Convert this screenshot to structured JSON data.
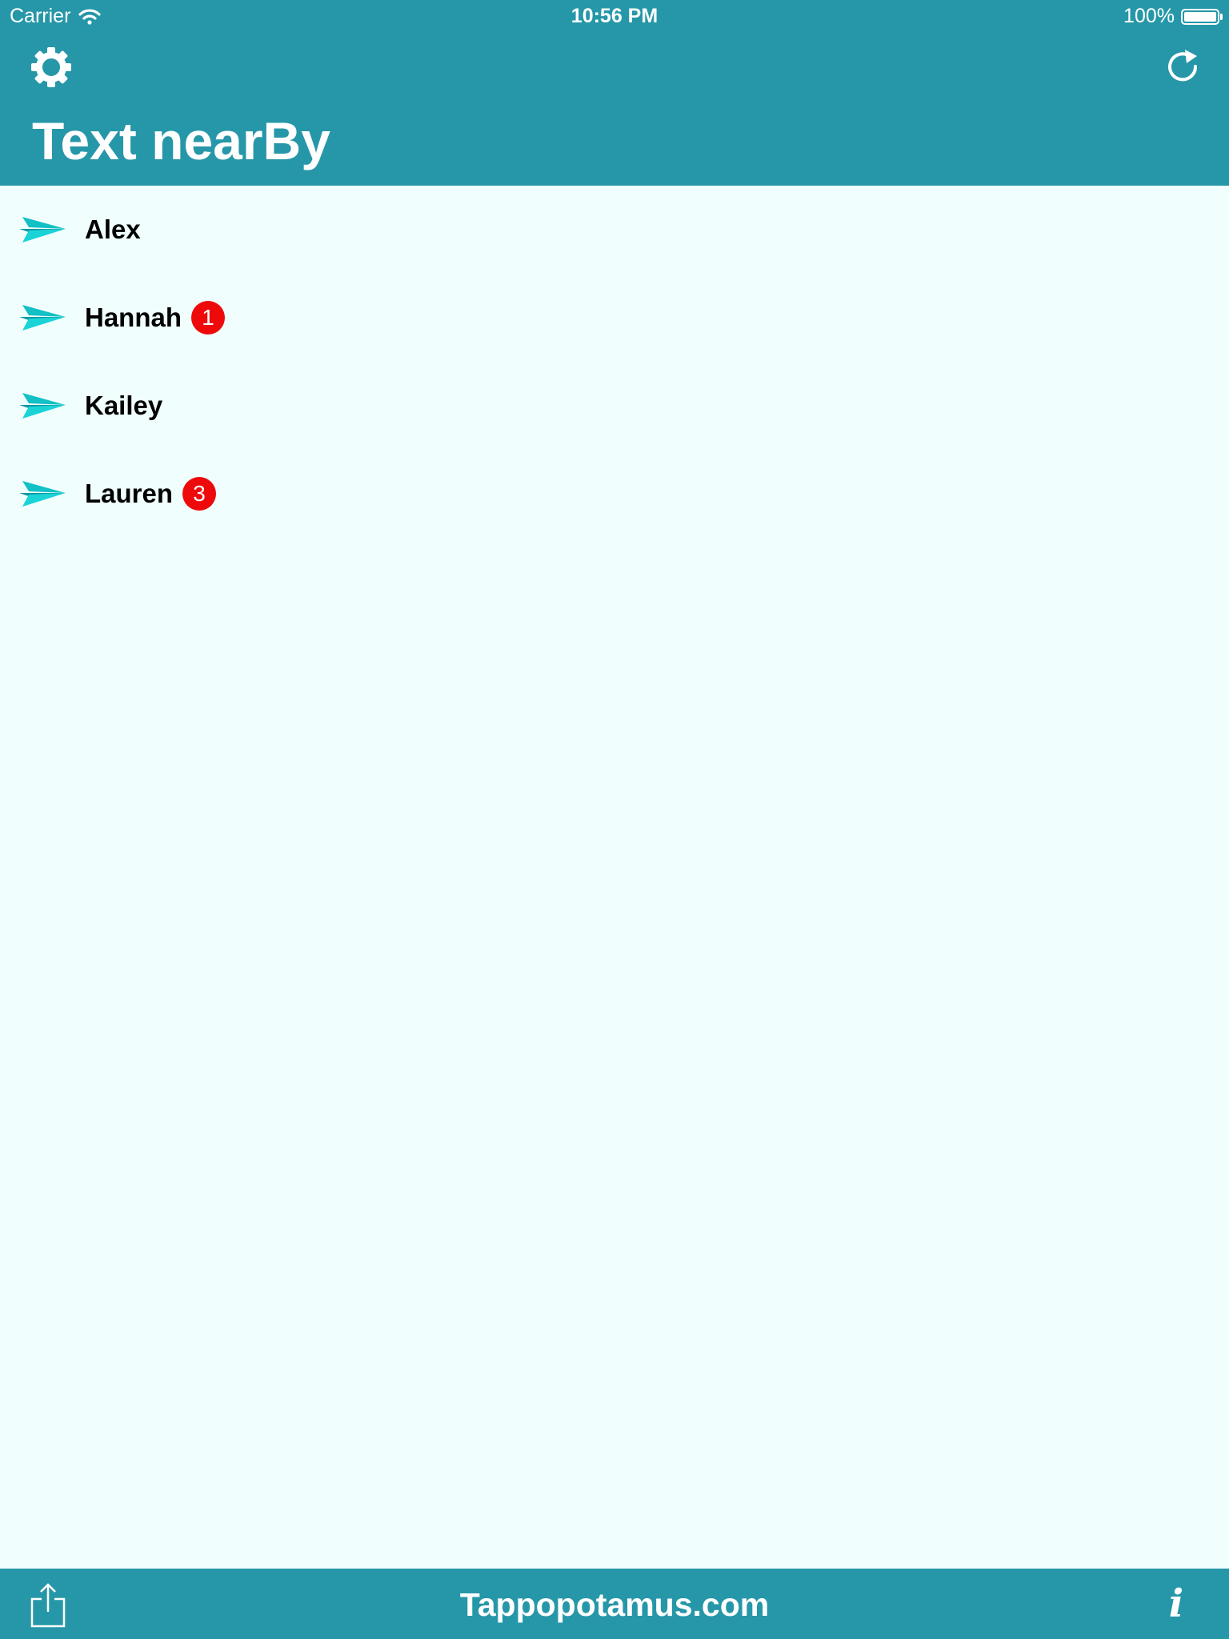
{
  "status_bar": {
    "carrier": "Carrier",
    "time": "10:56 PM",
    "battery": "100%"
  },
  "header": {
    "title": "Text nearBy",
    "settings_icon": "gear-icon",
    "refresh_icon": "refresh-icon"
  },
  "contacts": [
    {
      "name": "Alex",
      "badge": ""
    },
    {
      "name": "Hannah",
      "badge": "1"
    },
    {
      "name": "Kailey",
      "badge": ""
    },
    {
      "name": "Lauren",
      "badge": "3"
    }
  ],
  "footer": {
    "link_text": "Tappopotamus.com",
    "info_label": "i",
    "share_icon": "share-icon"
  },
  "colors": {
    "bar": "#2697A8",
    "background": "#F0FFFE",
    "accent": "#13C0C6",
    "badge": "#EE0A0A"
  }
}
